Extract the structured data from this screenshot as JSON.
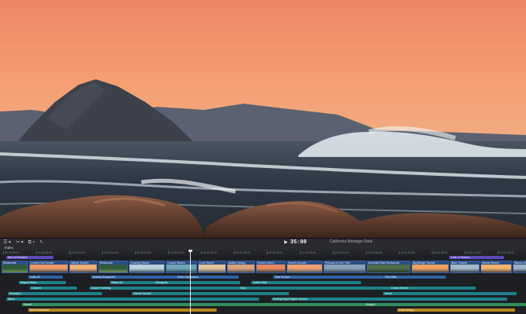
{
  "toolbar": {
    "left_buttons": [
      "☰ ▾",
      "✂ ▾",
      "⧉ ▾",
      "↖"
    ],
    "play_icon": "play-icon",
    "timecode": "35:00",
    "project_name": "California Montage Final"
  },
  "timeline": {
    "index_label": "Index",
    "ruler_ticks": [
      "00:00:00:00",
      "00:00:05:00",
      "00:00:10:00",
      "00:00:15:00",
      "00:00:20:00",
      "00:00:25:00",
      "00:00:30:00",
      "00:00:35:00",
      "00:00:40:00",
      "00:00:45:00",
      "00:00:50:00",
      "00:00:55:00",
      "00:01:00:00",
      "00:01:05:00",
      "00:01:10:00",
      "00:01:15:00"
    ],
    "top_bars": [
      {
        "label": "Bird of Paradise",
        "color": "purple"
      },
      {
        "label": "Gate of Heaven",
        "color": "purple"
      }
    ],
    "clips": [
      "Redwoods",
      "Lonely Gull Sunset",
      "Harbor Sunset",
      "Redwoods",
      "Chasing Waves",
      "Crystal Waters",
      "Lone Heron",
      "Malibu Spring",
      "Surfers Morro",
      "Harvey Sunset",
      "Pelicans of Iron Park",
      "Mountain Bike Redwoods",
      "Big Bridge Sunset",
      "Bear Trouble",
      "Sunset Beach",
      "Waves Wide Rock"
    ],
    "lanes": [
      {
        "label": "",
        "bars": [
          {
            "text": "Gulls 04",
            "color": "blue"
          },
          {
            "text": "Seabird Response",
            "color": "blue"
          },
          {
            "text": "Deep Exploration",
            "color": "blue"
          },
          {
            "text": "Tree Sunset",
            "color": "blue"
          },
          {
            "text": "Tree Mills",
            "color": "blue"
          }
        ]
      },
      {
        "label": "",
        "bars": [
          {
            "text": "Sequel Wave",
            "color": "teal"
          },
          {
            "text": "Water Air",
            "color": "teal"
          },
          {
            "text": "Ravagulls",
            "color": "teal"
          },
          {
            "text": "Traffic Walk",
            "color": "teal"
          }
        ]
      },
      {
        "label": "",
        "bars": [
          {
            "text": "Crisped",
            "color": "teal"
          },
          {
            "text": "Glacier Evening",
            "color": "teal"
          },
          {
            "text": "Ship",
            "color": "teal"
          },
          {
            "text": "Ocean Breeze",
            "color": "teal"
          }
        ]
      },
      {
        "label": "",
        "bars": [
          {
            "text": "Seawall 1",
            "color": "teal"
          },
          {
            "text": "Harbor Sound",
            "color": "teal"
          },
          {
            "text": "Shore",
            "color": "teal"
          }
        ]
      },
      {
        "label": "",
        "bars": [
          {
            "text": "Wave",
            "color": "teal"
          },
          {
            "text": "Surfing Dog English Version",
            "color": "teal"
          }
        ]
      },
      {
        "label": "",
        "bars": [
          {
            "text": "Sound",
            "color": "green"
          },
          {
            "text": "Seagull",
            "color": "green"
          }
        ]
      },
      {
        "label": "",
        "bars": [
          {
            "text": "Surf Heat Wave",
            "color": "orange"
          },
          {
            "text": "Gulf Surfing",
            "color": "orange"
          }
        ]
      }
    ]
  },
  "colors": {
    "sky_top": "#f08a66",
    "sky_mid": "#f6a97a",
    "rock_dark": "#3b3f47",
    "sea": "#2b3642",
    "surf": "#e8eef3",
    "foreground_rock": "#6b4434"
  }
}
